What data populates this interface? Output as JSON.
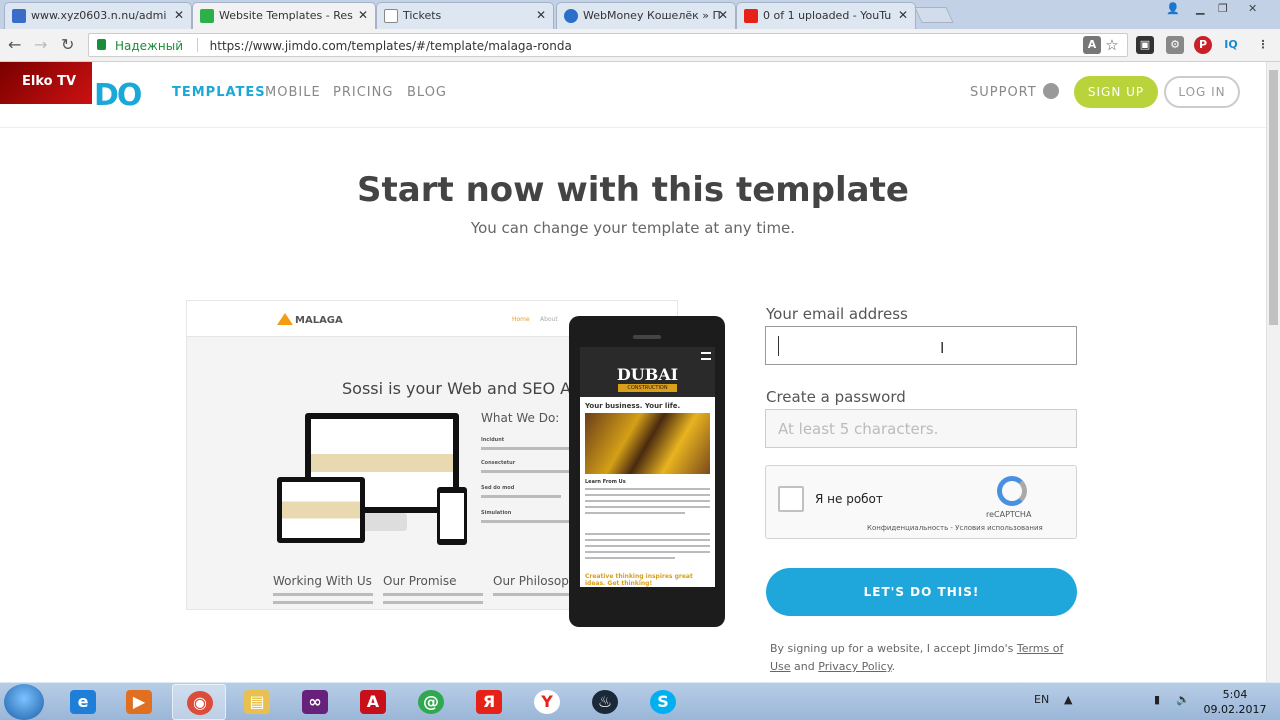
{
  "browser": {
    "tabs": [
      {
        "title": "www.xyz0603.n.nu/admi",
        "favicon": "link-icon",
        "color": "#3a6cc8"
      },
      {
        "title": "Website Templates - Res",
        "favicon": "jimdo-icon",
        "color": "#2bb04a"
      },
      {
        "title": "Tickets",
        "favicon": "page-icon",
        "color": "#ffffff"
      },
      {
        "title": "WebMoney Кошелёк » П",
        "favicon": "webmoney-icon",
        "color": "#2a6fc9"
      },
      {
        "title": "0 of 1 uploaded - YouTu",
        "favicon": "youtube-icon",
        "color": "#e62117"
      }
    ],
    "active_tab": 1,
    "address": {
      "secure_label": "Надежный",
      "url": "https://www.jimdo.com/templates/#/template/malaga-ronda"
    }
  },
  "overlay_label": "Elko TV",
  "site": {
    "logo_text": "DO",
    "nav": [
      "TEMPLATES",
      "MOBILE",
      "PRICING",
      "BLOG"
    ],
    "support": "SUPPORT",
    "signup": "SIGN UP",
    "login": "LOG IN"
  },
  "hero": {
    "title": "Start now with this template",
    "subtitle": "You can change your template at any time."
  },
  "preview": {
    "brand": "MALAGA",
    "menu": [
      "Home",
      "About"
    ],
    "headline": "Sossi is your Web and SEO Agen",
    "what_we_do": "What We Do:",
    "items": [
      "Incidunt",
      "Consectetur",
      "Sed do mod",
      "Simulation"
    ],
    "footer": [
      "Working With Us",
      "Our Promise",
      "Our Philosoph"
    ],
    "phone": {
      "name": "DUBAI",
      "sub": "CONSTRUCTION",
      "tagline": "Your business. Your life.",
      "learn": "Learn From Us",
      "creative": "Creative thinking inspires great ideas. Get thinking!"
    }
  },
  "form": {
    "email_label": "Your email address",
    "email_value": "",
    "password_label": "Create a password",
    "password_placeholder": "At least 5 characters.",
    "captcha_label": "Я не робот",
    "captcha_brand": "reCAPTCHA",
    "captcha_links": "Конфиденциальность - Условия использования",
    "submit": "LET'S DO THIS!",
    "terms_prefix": "By signing up for a website, I accept Jimdo's ",
    "terms_link": "Terms of Use",
    "terms_and": " and ",
    "privacy_link": "Privacy Policy",
    "terms_suffix": "."
  },
  "taskbar": {
    "apps": [
      "ie-icon",
      "media-player-icon",
      "chrome-icon",
      "explorer-icon",
      "visual-studio-icon",
      "pdf-icon",
      "icq-icon",
      "yandex-icon",
      "yandex-browser-icon",
      "steam-icon",
      "skype-icon"
    ],
    "lang": "EN",
    "time": "5:04",
    "date": "09.02.2017"
  }
}
